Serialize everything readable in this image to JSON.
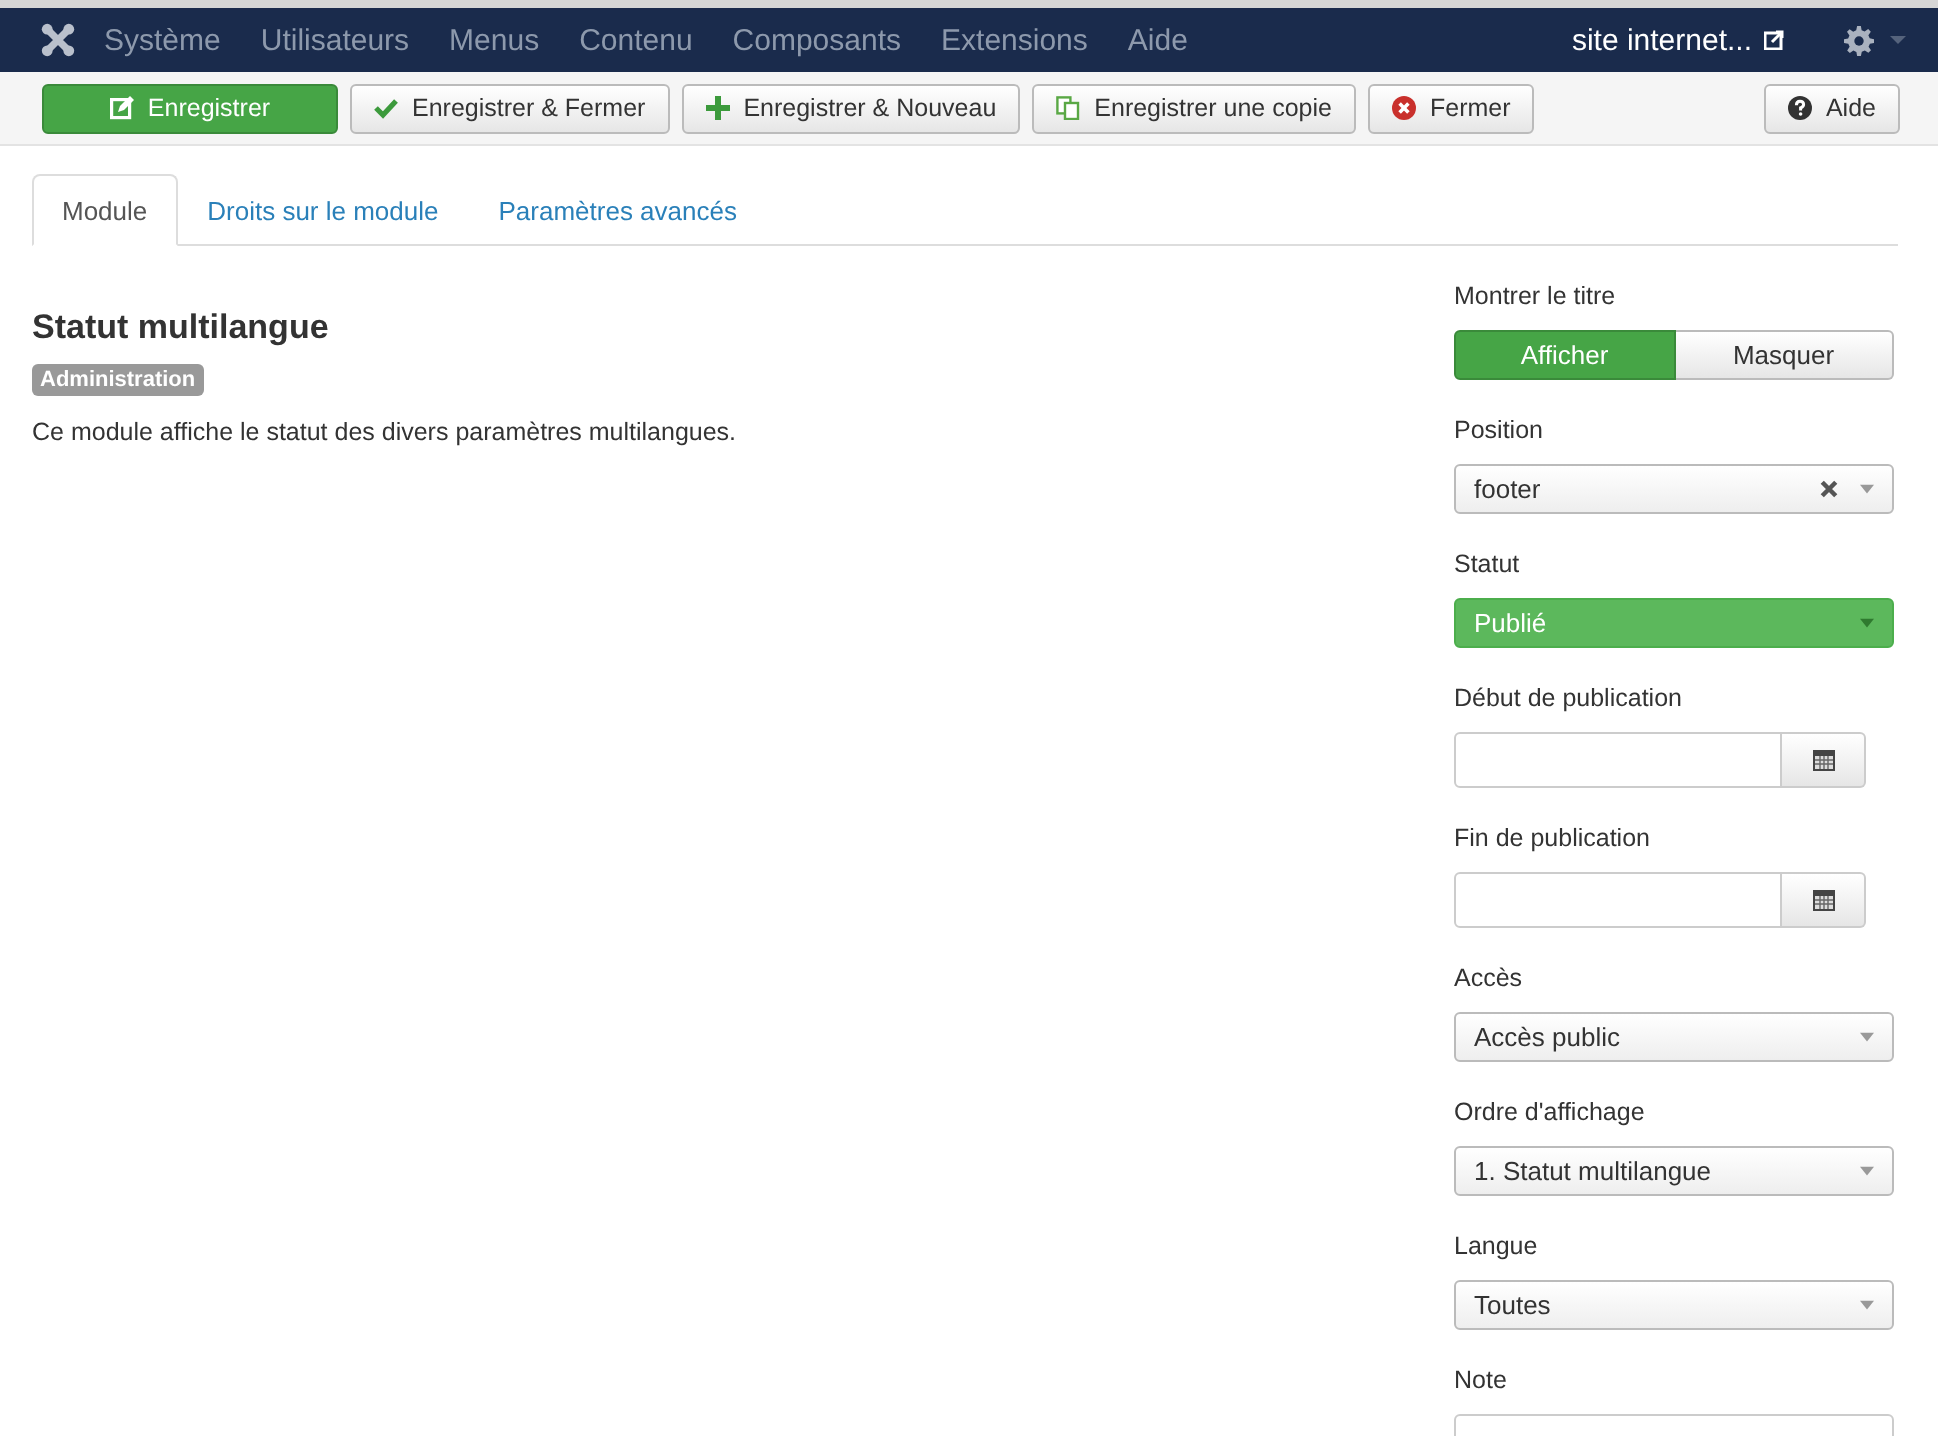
{
  "navbar": {
    "menu": [
      "Système",
      "Utilisateurs",
      "Menus",
      "Contenu",
      "Composants",
      "Extensions",
      "Aide"
    ],
    "site_link": "site internet..."
  },
  "toolbar": {
    "buttons": [
      {
        "label": "Enregistrer",
        "kind": "save",
        "primary": true
      },
      {
        "label": "Enregistrer & Fermer",
        "kind": "check",
        "primary": false
      },
      {
        "label": "Enregistrer & Nouveau",
        "kind": "plus",
        "primary": false
      },
      {
        "label": "Enregistrer une copie",
        "kind": "copy",
        "primary": false
      },
      {
        "label": "Fermer",
        "kind": "close",
        "primary": false
      }
    ],
    "help_button": "Aide"
  },
  "tabs": [
    {
      "label": "Module",
      "selected": true
    },
    {
      "label": "Droits sur le module",
      "selected": false
    },
    {
      "label": "Paramètres avancés",
      "selected": false
    }
  ],
  "module": {
    "title": "Statut multilangue",
    "badge": "Administration",
    "description": "Ce module affiche le statut des divers paramètres multilangues."
  },
  "fields": [
    {
      "label": "Montrer le titre",
      "kind": "toggle",
      "options": [
        {
          "label": "Afficher",
          "selected": true
        },
        {
          "label": "Masquer",
          "selected": false
        }
      ]
    },
    {
      "label": "Position",
      "kind": "select",
      "value": "footer",
      "clearable": true
    },
    {
      "label": "Statut",
      "kind": "status",
      "value": "Publié"
    },
    {
      "label": "Début de publication",
      "kind": "date"
    },
    {
      "label": "Fin de publication",
      "kind": "date"
    },
    {
      "label": "Accès",
      "kind": "select",
      "value": "Accès public",
      "clearable": false
    },
    {
      "label": "Ordre d'affichage",
      "kind": "select",
      "value": "1. Statut multilangue",
      "clearable": false
    },
    {
      "label": "Langue",
      "kind": "select",
      "value": "Toutes",
      "clearable": false
    },
    {
      "label": "Note",
      "kind": "text"
    }
  ]
}
